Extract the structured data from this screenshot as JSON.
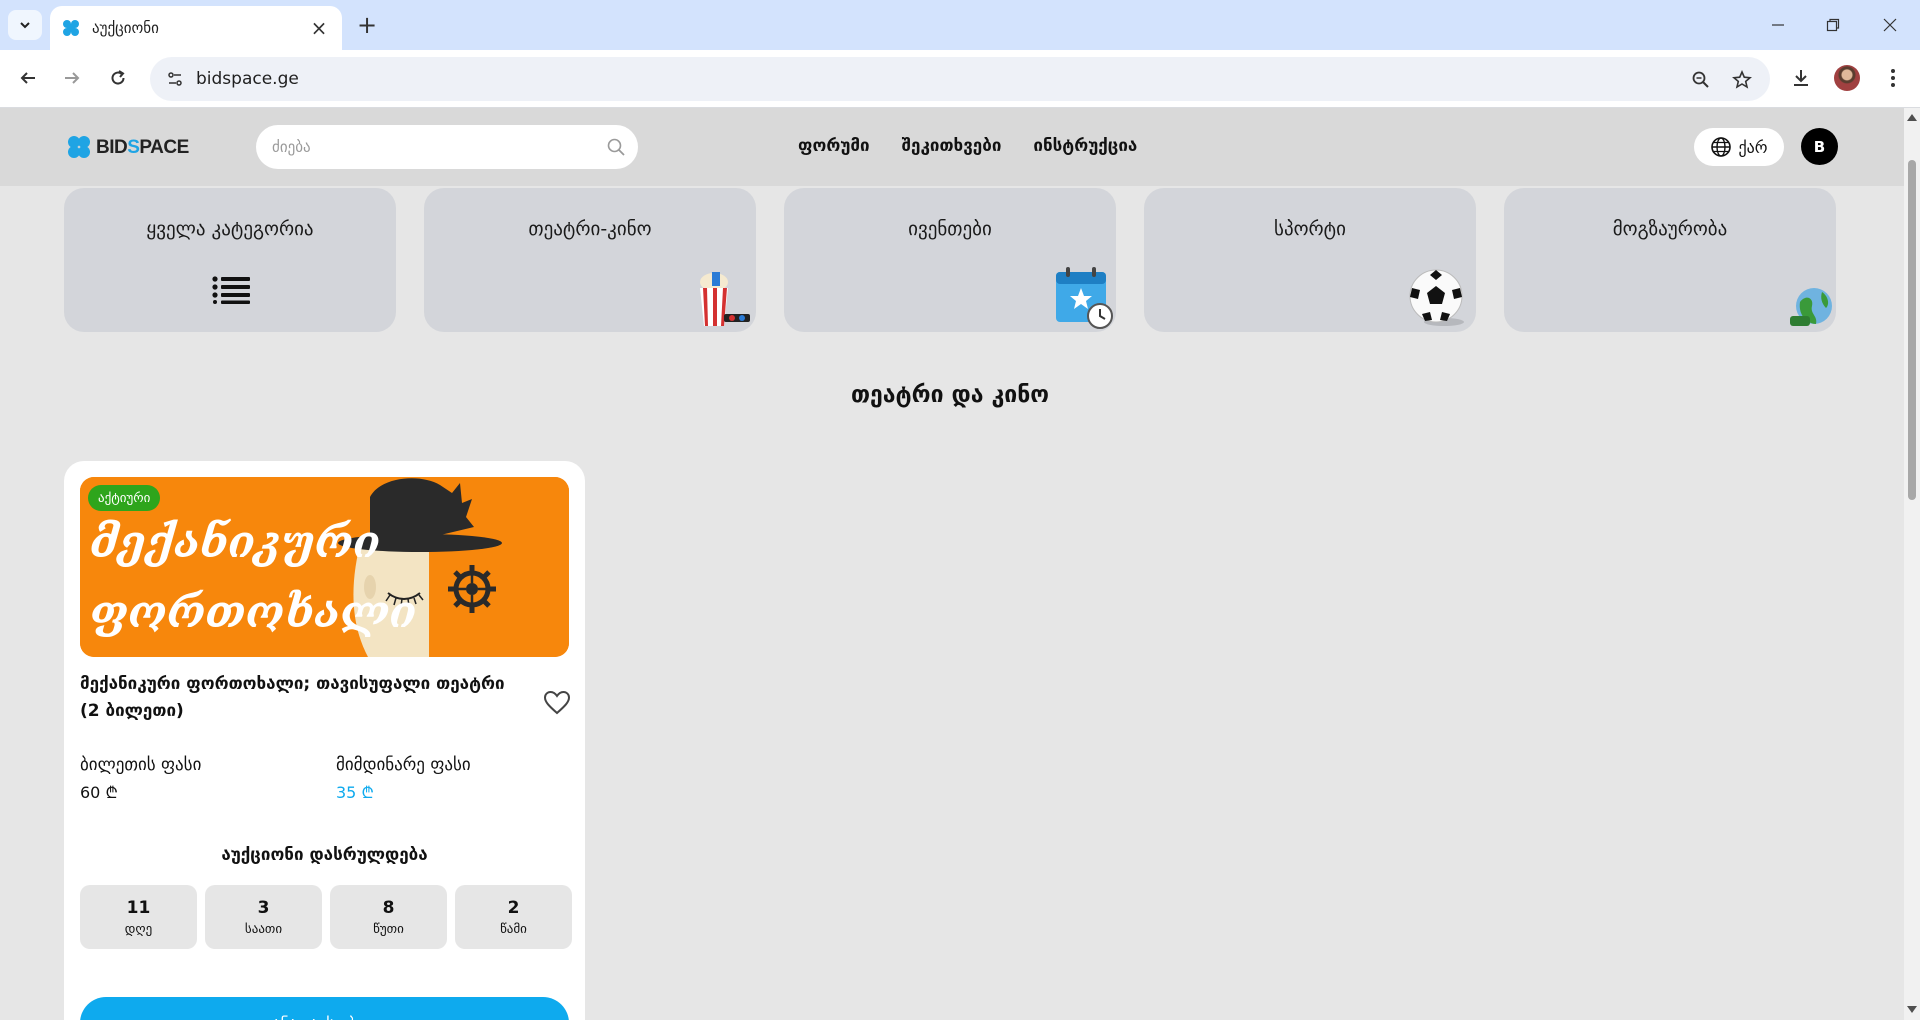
{
  "browser": {
    "tab_title": "აუქციონი",
    "url": "bidspace.ge"
  },
  "header": {
    "logo_text_part1": "BID",
    "logo_text_part2": "S",
    "logo_text_part3": "PACE",
    "search_placeholder": "ძიება",
    "nav": [
      "ფორუმი",
      "შეკითხვები",
      "ინსტრუქცია"
    ],
    "language": "ქარ",
    "user_initial": "B"
  },
  "categories": [
    {
      "label": "ყველა კატეგორია",
      "icon": "list-icon"
    },
    {
      "label": "თეატრი-კინო",
      "icon": "popcorn-icon"
    },
    {
      "label": "ივენთები",
      "icon": "calendar-icon"
    },
    {
      "label": "სპორტი",
      "icon": "soccer-ball-icon"
    },
    {
      "label": "მოგზაურობა",
      "icon": "globe-icon"
    }
  ],
  "section_title": "თეატრი და კინო",
  "card": {
    "status": "აქტიური",
    "image_text_line1": "მექანიკური",
    "image_text_line2": "ფორთოხალი",
    "title": "მექანიკური ფორთოხალი; თავისუფალი თეატრი (2 ბილეთი)",
    "ticket_price_label": "ბილეთის ფასი",
    "ticket_price": "60 ₾",
    "current_price_label": "მიმდინარე ფასი",
    "current_price": "35 ₾",
    "ends_label": "აუქციონი დასრულდება",
    "countdown": [
      {
        "value": "11",
        "unit": "დღე"
      },
      {
        "value": "3",
        "unit": "საათი"
      },
      {
        "value": "8",
        "unit": "წუთი"
      },
      {
        "value": "2",
        "unit": "წამი"
      }
    ],
    "bid_button": "განათავსე ბიდი"
  },
  "colors": {
    "accent": "#0eaaee",
    "badge": "#2ea51c",
    "image_bg": "#f7870c",
    "current_price": "#0eaaee"
  }
}
